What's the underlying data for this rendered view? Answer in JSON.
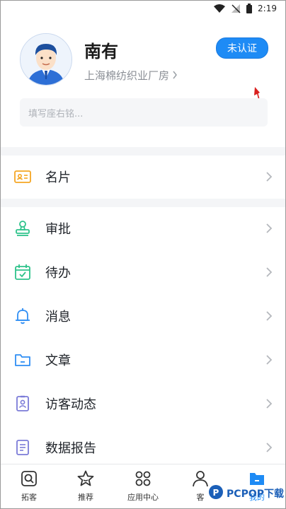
{
  "status_bar": {
    "time": "2:19"
  },
  "profile": {
    "name": "南有",
    "company": "上海棉纺织业厂房",
    "verify_label": "未认证",
    "motto_placeholder": "填写座右铭..."
  },
  "menu": {
    "card": "名片",
    "approval": "审批",
    "todo": "待办",
    "messages": "消息",
    "articles": "文章",
    "visitor_activity": "访客动态",
    "data_report": "数据报告"
  },
  "tabs": [
    {
      "label": "拓客"
    },
    {
      "label": "推荐"
    },
    {
      "label": "应用中心"
    },
    {
      "label": "客"
    },
    {
      "label": "我的"
    }
  ],
  "watermark": {
    "text": "PCPOP下载"
  },
  "colors": {
    "accent": "#1e8bf5",
    "icon_orange": "#f5a623",
    "icon_green": "#2ec38b",
    "icon_blue": "#2f8ef4",
    "icon_purple": "#7b7bd8"
  }
}
